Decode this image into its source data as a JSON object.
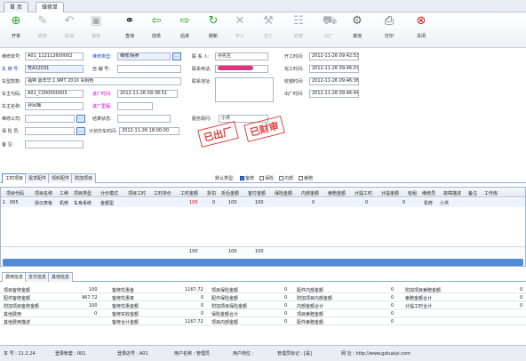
{
  "tabs": [
    {
      "label": "首 页"
    },
    {
      "label": "维修单"
    }
  ],
  "toolbar": [
    "开单",
    "修改",
    "取消",
    "保存",
    "查询",
    "前单",
    "后单",
    "刷新",
    "开工",
    "完工",
    "收银",
    "出厂",
    "其他",
    "打印",
    "关闭"
  ],
  "form": {
    "order_no_label": "维修单号:",
    "order_no": "A01_112112600002",
    "plate_label": "车 牌 号:",
    "plate": "粤A22031",
    "model_label": "车型款数:",
    "model": "福特 嘉年华 1.9MT 2010 青铜色",
    "owner_code_label": "车主代码:",
    "owner_code": "A01_C000000003",
    "owner_name_label": "车主名称:",
    "owner_name": "孙凤梅",
    "addr_label": "维修公司:",
    "insurer_label": "保 险 员:",
    "remark_label": "备 注:",
    "repair_type_label": "维修类型:",
    "repair_type": "维修/保养",
    "self_no_label": "自 编 号:",
    "entry_time_label": "进厂时间:",
    "entry_time": "2012-11-26  09:38:51",
    "entry_mileage_label": "进厂里程:",
    "settle_label": "结算状态:",
    "plan_label": "计划交车时间:",
    "plan_time": "2012-11-26  18:00:00",
    "contact_label": "联 系 人:",
    "contact": "孙先生",
    "phone_label": "联系电话:",
    "phone_addr_label": "联系地址:",
    "advisor_label": "服务顾问:",
    "advisor": "小洪",
    "start_label": "开工时间:",
    "start_time": "2012-11-26 09:42:53",
    "finish_label": "完工时间:",
    "finish_time": "2012-11-26 09:46:07",
    "cash_label": "收银时间:",
    "cash_time": "2012-11-26 09:46:36",
    "out_label": "出厂时间:",
    "out_time": "2012-11-26 09:46:44",
    "stamp1": "已出厂",
    "stamp2": "已财审"
  },
  "section_tabs": [
    "工时项目",
    "需求配件",
    "领料配件",
    "附加项目"
  ],
  "default_label": "默认类型:",
  "types": [
    "客修",
    "保险",
    "内部",
    "索赔"
  ],
  "grid": {
    "headers": [
      "项目代码",
      "项目名称",
      "工种",
      "项目类型",
      "计价模式",
      "项目工时",
      "工时单价",
      "工时金额",
      "折扣",
      "折后金额",
      "客付金额",
      "保险金额",
      "内部金额",
      "索赔金额",
      "计提工时",
      "计提金额",
      "班组",
      "维修员",
      "故障描述",
      "备注",
      "工作库"
    ],
    "row": [
      "1",
      "005",
      "拆仪表板",
      "机修",
      "车身系统",
      "金额型",
      "",
      "",
      "100",
      "0",
      "100",
      "100",
      "",
      "0",
      "",
      "0",
      "",
      "0",
      "",
      "机修",
      "小洪"
    ],
    "sum": [
      "100",
      "100",
      "100"
    ]
  },
  "bottom_tabs": [
    "费用信息",
    "支付信息",
    "其他信息"
  ],
  "fees": [
    [
      "项目客修金额",
      "100",
      "客修优惠金",
      "1167.72",
      "项目保险金额",
      "0",
      "配件内部金额",
      "0",
      "附加项目索赔金额",
      "0"
    ],
    [
      "配件客修金额",
      "967.72",
      "客修优惠率",
      "0",
      "配件保险金额",
      "0",
      "附加项目内部金额",
      "0",
      "索赔金额合计",
      "0"
    ],
    [
      "附加项目客修金额",
      "100",
      "客修优惠金额",
      "0",
      "附加项目保险金额",
      "0",
      "内部金额合计",
      "0",
      "计提工时合计",
      "0"
    ],
    [
      "其他费用",
      "0",
      "客修实收金额",
      "0",
      "保险金额合计",
      "0",
      "项目索赔金额",
      "0",
      "",
      ""
    ],
    [
      "其他费用描述",
      "",
      "客修合计金额",
      "1167.72",
      "项目内部金额",
      "0",
      "配件索赔金额",
      "0",
      "",
      ""
    ]
  ],
  "status": [
    "本 号 : 11.2.24",
    "登录帐套 : 001",
    "登录店号 : A01",
    "用户名称 : 管理员",
    "用户岗位 :",
    "管理员标记 : [是]",
    "网  址 : http://www.gzkuaiyi.com"
  ],
  "colors": {
    "accent": "#3b7ad6",
    "stamp": "#e02b2b",
    "label_blue": "#1646c8"
  }
}
